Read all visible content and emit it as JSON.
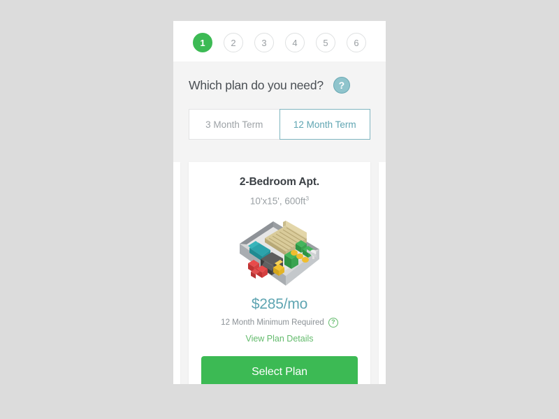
{
  "stepper": {
    "steps": [
      {
        "label": "1",
        "active": true
      },
      {
        "label": "2",
        "active": false
      },
      {
        "label": "3",
        "active": false
      },
      {
        "label": "4",
        "active": false
      },
      {
        "label": "5",
        "active": false
      },
      {
        "label": "6",
        "active": false
      }
    ]
  },
  "header": {
    "title": "Which plan do you need?",
    "help_icon": "?",
    "help_icon_name": "question-mark-icon"
  },
  "term_toggle": {
    "options": [
      {
        "label": "3 Month Term",
        "selected": false
      },
      {
        "label": "12 Month Term",
        "selected": true
      }
    ]
  },
  "card": {
    "title": "2-Bedroom Apt.",
    "dimensions": "10'x15', 600ft",
    "dimensions_superscript": "3",
    "illustration_name": "storage-unit-isometric-illustration",
    "price": "$285/mo",
    "minimum_required": "12 Month Minimum Required",
    "minimum_help_icon": "?",
    "plan_details_link": "View Plan Details",
    "select_button": "Select Plan"
  },
  "colors": {
    "page_background": "#dcdcdc",
    "panel_background": "#ffffff",
    "band_background": "#f4f4f4",
    "accent_green": "#3cba54",
    "link_green": "#63bb6c",
    "accent_teal": "#5fa5b2",
    "help_teal": "#8fc4cc",
    "muted_text": "#9aa0a4",
    "title_text": "#4a4f54"
  }
}
